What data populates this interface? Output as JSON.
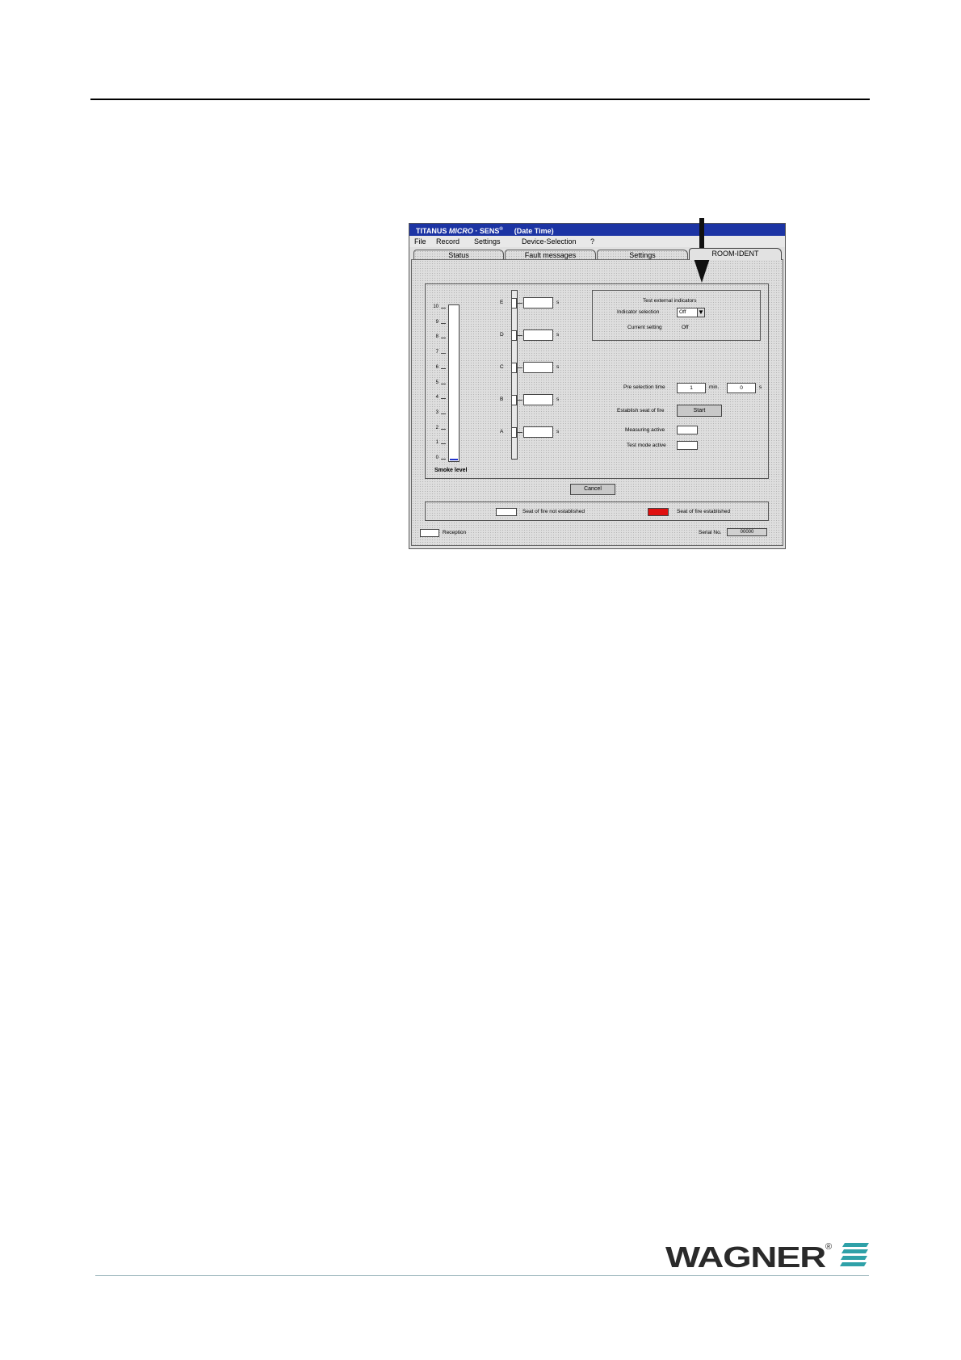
{
  "app": {
    "title": "TITANUS ",
    "title_italic": "MICRO",
    "title_rest": " · SENS",
    "title_sup": "®",
    "date_time": "(Date  Time)"
  },
  "menu": [
    "File",
    "Record",
    "Settings",
    "Device-Selection",
    "?"
  ],
  "tabs": [
    {
      "label": "Status",
      "active": false
    },
    {
      "label": "Fault messages",
      "active": false
    },
    {
      "label": "Settings",
      "active": false
    },
    {
      "label": "ROOM-IDENT",
      "active": true
    }
  ],
  "gauge": {
    "ticks": [
      "10",
      "9",
      "8",
      "7",
      "6",
      "5",
      "4",
      "3",
      "2",
      "1",
      "0"
    ],
    "label": "Smoke level",
    "level": 0.1,
    "max": 10,
    "fill_color": "#2233cc"
  },
  "zones": [
    {
      "id": "E",
      "value": "",
      "unit": "s"
    },
    {
      "id": "D",
      "value": "",
      "unit": "s"
    },
    {
      "id": "C",
      "value": "",
      "unit": "s"
    },
    {
      "id": "B",
      "value": "",
      "unit": "s"
    },
    {
      "id": "A",
      "value": "",
      "unit": "s"
    }
  ],
  "indicators": {
    "group_title": "Test external indicators",
    "selection_label": "Indicator selection",
    "selection_value": "Off",
    "dropdown_glyph": "▼",
    "current_label": "Current setting",
    "current_value": "Off"
  },
  "preselection": {
    "label": "Pre selection time",
    "min_value": "1",
    "min_unit": "min.",
    "sec_value": "0",
    "sec_unit": "s"
  },
  "establish": {
    "label": "Establish seat of fire",
    "button": "Start"
  },
  "measuring_active": "Measuring active",
  "test_mode_active": "Test mode active",
  "cancel_button": "Cancel",
  "legend": {
    "not_established": "Seat of fire not established",
    "established": "Seat of fire established",
    "established_color": "#e01010"
  },
  "footer": {
    "reception": "Reception",
    "serial_label": "Serial No.",
    "serial_value": "00000"
  },
  "logo": {
    "text": "WAGNER",
    "registered": "®",
    "color": "#2a2a2a",
    "accent": "#2fa1a8"
  }
}
